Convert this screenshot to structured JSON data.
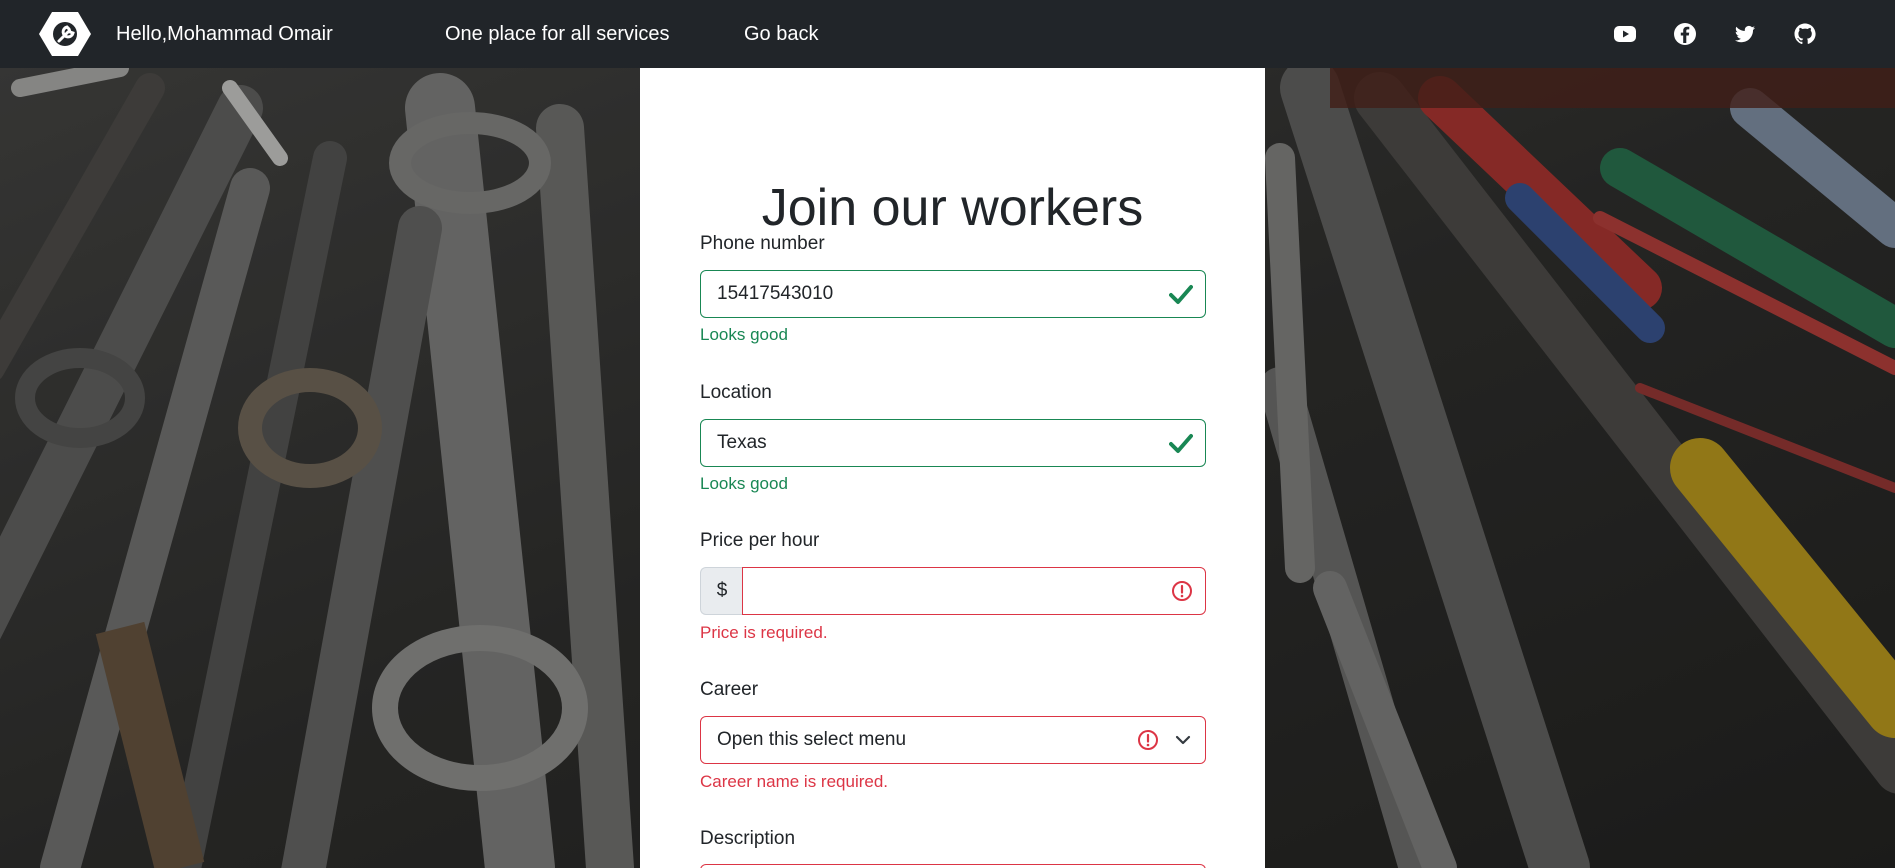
{
  "nav": {
    "greeting": "Hello,Mohammad Omair",
    "services": "One place for all services",
    "back": "Go back",
    "social": [
      "youtube-icon",
      "facebook-icon",
      "twitter-icon",
      "github-icon"
    ]
  },
  "form": {
    "title": "Join our workers",
    "phone": {
      "label": "Phone number",
      "value": "15417543010",
      "feedback": "Looks good"
    },
    "location": {
      "label": "Location",
      "value": "Texas",
      "feedback": "Looks good"
    },
    "price": {
      "label": "Price per hour",
      "prefix": "$",
      "value": "",
      "feedback": "Price is required."
    },
    "career": {
      "label": "Career",
      "selected": "Open this select menu",
      "feedback": "Career name is required."
    },
    "description": {
      "label": "Description"
    }
  },
  "colors": {
    "navbar": "#212529",
    "valid": "#198754",
    "invalid": "#dc3545",
    "card": "#ffffff"
  }
}
